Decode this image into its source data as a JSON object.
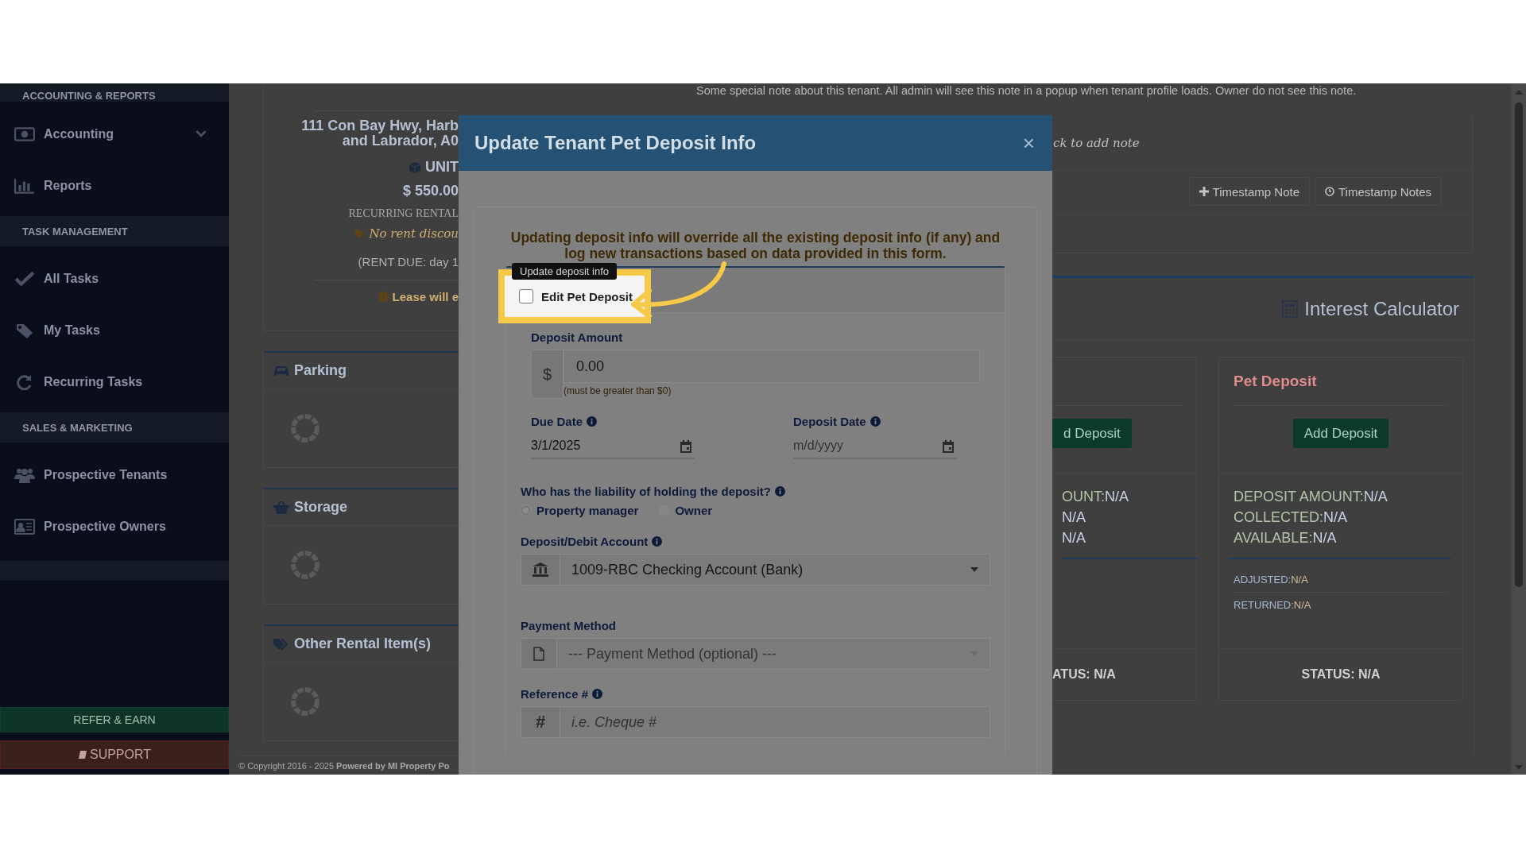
{
  "sidebar": {
    "sections": [
      {
        "heading": "ACCOUNTING & REPORTS",
        "items": [
          {
            "label": "Accounting",
            "expandable": true
          },
          {
            "label": "Reports",
            "expandable": false
          }
        ]
      },
      {
        "heading": "TASK MANAGEMENT",
        "items": [
          {
            "label": "All Tasks",
            "expandable": false
          },
          {
            "label": "My Tasks",
            "expandable": false
          },
          {
            "label": "Recurring Tasks",
            "expandable": false
          }
        ]
      },
      {
        "heading": "SALES & MARKETING",
        "items": [
          {
            "label": "Prospective Tenants",
            "expandable": false
          },
          {
            "label": "Prospective Owners",
            "expandable": false
          }
        ]
      }
    ],
    "refer_button": "REFER & EARN",
    "support_button": "SUPPORT"
  },
  "tenant_summary": {
    "address_lines": [
      "111 Con Bay Hwy, Harb",
      "and Labrador, A0"
    ],
    "unit": "UNIT",
    "rent": "$ 550.00",
    "rent_label": "RECURRING RENTAL",
    "discount": "No rent discou",
    "rent_due": "(RENT DUE: day 1",
    "lease_note": "Lease will e"
  },
  "rental_sections": [
    {
      "title": "Parking",
      "loading": true
    },
    {
      "title": "Storage",
      "loading": true
    },
    {
      "title": "Other Rental Item(s)",
      "loading": true
    }
  ],
  "footer": "© Copyright 2016 - 2025 **Powered by MI Property Po**",
  "notes": {
    "text": "Some special note about this tenant. All admin will see this note in a popup when tenant profile loads. Owner do not see this note.",
    "add_note": "ck to add note",
    "buttons": [
      "Timestamp Note",
      "Timestamp Notes"
    ]
  },
  "deposits": {
    "title": "Interest Calculator",
    "cards": [
      {
        "button": "d Deposit",
        "amounts": [
          {
            "label": "OUNT:",
            "value": "N/A"
          },
          {
            "value": "N/A"
          },
          {
            "value": "N/A"
          }
        ],
        "status": "ATUS: N/A"
      },
      {
        "title": "Pet Deposit",
        "button": "Add Deposit",
        "amounts": [
          {
            "label": "DEPOSIT AMOUNT:",
            "value": "N/A"
          },
          {
            "label": "COLLECTED:",
            "value": "N/A"
          },
          {
            "label": "AVAILABLE:",
            "value": "N/A"
          }
        ],
        "details": [
          {
            "label": "ADJUSTED:",
            "value": "N/A"
          },
          {
            "label": "RETURNED:",
            "value": "N/A"
          }
        ],
        "status": "STATUS: N/A"
      }
    ]
  },
  "modal": {
    "title": "Update Tenant Pet Deposit Info",
    "close": "×",
    "warning": "Updating deposit info will override all the existing deposit info (if any) and log new transactions based on data provided in this form.",
    "tooltip": "Update deposit info",
    "edit_toggle": {
      "label": "Edit Pet Deposit",
      "checked": false
    },
    "deposit_amount": {
      "label": "Deposit Amount",
      "prefix": "$",
      "value": "0.00",
      "help": "(must be greater than $0)"
    },
    "due_date": {
      "label": "Due Date",
      "value": "3/1/2025"
    },
    "deposit_date": {
      "label": "Deposit Date",
      "placeholder": "m/d/yyyy"
    },
    "liability": {
      "question": "Who has the liability of holding the deposit?",
      "options": [
        {
          "label": "Property manager",
          "selected": true
        },
        {
          "label": "Owner",
          "selected": false
        }
      ]
    },
    "account": {
      "label": "Deposit/Debit Account",
      "value": "1009-RBC Checking Account (Bank)"
    },
    "payment_method": {
      "label": "Payment Method",
      "placeholder": "--- Payment Method (optional) ---"
    },
    "reference": {
      "label": "Reference #",
      "prefix": "#",
      "placeholder": "i.e. Cheque #"
    }
  }
}
